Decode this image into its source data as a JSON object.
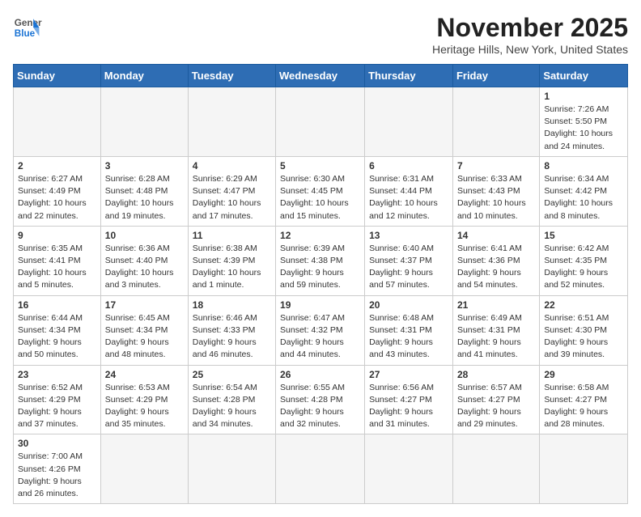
{
  "header": {
    "logo_general": "General",
    "logo_blue": "Blue",
    "month_title": "November 2025",
    "location": "Heritage Hills, New York, United States"
  },
  "days_of_week": [
    "Sunday",
    "Monday",
    "Tuesday",
    "Wednesday",
    "Thursday",
    "Friday",
    "Saturday"
  ],
  "weeks": [
    [
      {
        "day": "",
        "info": ""
      },
      {
        "day": "",
        "info": ""
      },
      {
        "day": "",
        "info": ""
      },
      {
        "day": "",
        "info": ""
      },
      {
        "day": "",
        "info": ""
      },
      {
        "day": "",
        "info": ""
      },
      {
        "day": "1",
        "info": "Sunrise: 7:26 AM\nSunset: 5:50 PM\nDaylight: 10 hours and 24 minutes."
      }
    ],
    [
      {
        "day": "2",
        "info": "Sunrise: 6:27 AM\nSunset: 4:49 PM\nDaylight: 10 hours and 22 minutes."
      },
      {
        "day": "3",
        "info": "Sunrise: 6:28 AM\nSunset: 4:48 PM\nDaylight: 10 hours and 19 minutes."
      },
      {
        "day": "4",
        "info": "Sunrise: 6:29 AM\nSunset: 4:47 PM\nDaylight: 10 hours and 17 minutes."
      },
      {
        "day": "5",
        "info": "Sunrise: 6:30 AM\nSunset: 4:45 PM\nDaylight: 10 hours and 15 minutes."
      },
      {
        "day": "6",
        "info": "Sunrise: 6:31 AM\nSunset: 4:44 PM\nDaylight: 10 hours and 12 minutes."
      },
      {
        "day": "7",
        "info": "Sunrise: 6:33 AM\nSunset: 4:43 PM\nDaylight: 10 hours and 10 minutes."
      },
      {
        "day": "8",
        "info": "Sunrise: 6:34 AM\nSunset: 4:42 PM\nDaylight: 10 hours and 8 minutes."
      }
    ],
    [
      {
        "day": "9",
        "info": "Sunrise: 6:35 AM\nSunset: 4:41 PM\nDaylight: 10 hours and 5 minutes."
      },
      {
        "day": "10",
        "info": "Sunrise: 6:36 AM\nSunset: 4:40 PM\nDaylight: 10 hours and 3 minutes."
      },
      {
        "day": "11",
        "info": "Sunrise: 6:38 AM\nSunset: 4:39 PM\nDaylight: 10 hours and 1 minute."
      },
      {
        "day": "12",
        "info": "Sunrise: 6:39 AM\nSunset: 4:38 PM\nDaylight: 9 hours and 59 minutes."
      },
      {
        "day": "13",
        "info": "Sunrise: 6:40 AM\nSunset: 4:37 PM\nDaylight: 9 hours and 57 minutes."
      },
      {
        "day": "14",
        "info": "Sunrise: 6:41 AM\nSunset: 4:36 PM\nDaylight: 9 hours and 54 minutes."
      },
      {
        "day": "15",
        "info": "Sunrise: 6:42 AM\nSunset: 4:35 PM\nDaylight: 9 hours and 52 minutes."
      }
    ],
    [
      {
        "day": "16",
        "info": "Sunrise: 6:44 AM\nSunset: 4:34 PM\nDaylight: 9 hours and 50 minutes."
      },
      {
        "day": "17",
        "info": "Sunrise: 6:45 AM\nSunset: 4:34 PM\nDaylight: 9 hours and 48 minutes."
      },
      {
        "day": "18",
        "info": "Sunrise: 6:46 AM\nSunset: 4:33 PM\nDaylight: 9 hours and 46 minutes."
      },
      {
        "day": "19",
        "info": "Sunrise: 6:47 AM\nSunset: 4:32 PM\nDaylight: 9 hours and 44 minutes."
      },
      {
        "day": "20",
        "info": "Sunrise: 6:48 AM\nSunset: 4:31 PM\nDaylight: 9 hours and 43 minutes."
      },
      {
        "day": "21",
        "info": "Sunrise: 6:49 AM\nSunset: 4:31 PM\nDaylight: 9 hours and 41 minutes."
      },
      {
        "day": "22",
        "info": "Sunrise: 6:51 AM\nSunset: 4:30 PM\nDaylight: 9 hours and 39 minutes."
      }
    ],
    [
      {
        "day": "23",
        "info": "Sunrise: 6:52 AM\nSunset: 4:29 PM\nDaylight: 9 hours and 37 minutes."
      },
      {
        "day": "24",
        "info": "Sunrise: 6:53 AM\nSunset: 4:29 PM\nDaylight: 9 hours and 35 minutes."
      },
      {
        "day": "25",
        "info": "Sunrise: 6:54 AM\nSunset: 4:28 PM\nDaylight: 9 hours and 34 minutes."
      },
      {
        "day": "26",
        "info": "Sunrise: 6:55 AM\nSunset: 4:28 PM\nDaylight: 9 hours and 32 minutes."
      },
      {
        "day": "27",
        "info": "Sunrise: 6:56 AM\nSunset: 4:27 PM\nDaylight: 9 hours and 31 minutes."
      },
      {
        "day": "28",
        "info": "Sunrise: 6:57 AM\nSunset: 4:27 PM\nDaylight: 9 hours and 29 minutes."
      },
      {
        "day": "29",
        "info": "Sunrise: 6:58 AM\nSunset: 4:27 PM\nDaylight: 9 hours and 28 minutes."
      }
    ],
    [
      {
        "day": "30",
        "info": "Sunrise: 7:00 AM\nSunset: 4:26 PM\nDaylight: 9 hours and 26 minutes."
      },
      {
        "day": "",
        "info": ""
      },
      {
        "day": "",
        "info": ""
      },
      {
        "day": "",
        "info": ""
      },
      {
        "day": "",
        "info": ""
      },
      {
        "day": "",
        "info": ""
      },
      {
        "day": "",
        "info": ""
      }
    ]
  ]
}
